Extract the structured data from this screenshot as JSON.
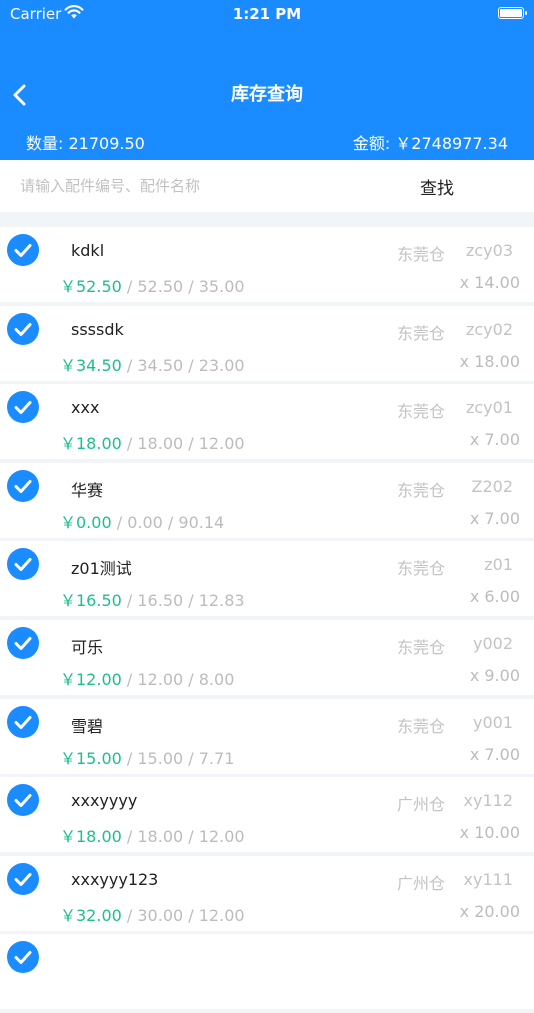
{
  "status": {
    "carrier": "Carrier",
    "time": "1:21 PM"
  },
  "header": {
    "title": "库存查询"
  },
  "summary": {
    "qty_label": "数量: 21709.50",
    "amount_label": "金额: ￥2748977.34"
  },
  "search": {
    "placeholder": "请输入配件编号、配件名称",
    "button_label": "查找"
  },
  "colors": {
    "primary": "#1a8cff",
    "price": "#1dbf8d",
    "muted": "#bcbcbc"
  },
  "items": [
    {
      "name": "kdkl",
      "warehouse": "东莞仓",
      "code": "zcy03",
      "price": "￥52.50",
      "details": " / 52.50 / 35.00",
      "qty": "x 14.00"
    },
    {
      "name": "ssssdk",
      "warehouse": "东莞仓",
      "code": "zcy02",
      "price": "￥34.50",
      "details": " / 34.50 / 23.00",
      "qty": "x 18.00"
    },
    {
      "name": "xxx",
      "warehouse": "东莞仓",
      "code": "zcy01",
      "price": "￥18.00",
      "details": " / 18.00 / 12.00",
      "qty": "x 7.00"
    },
    {
      "name": "华赛",
      "warehouse": "东莞仓",
      "code": "Z202",
      "price": "￥0.00",
      "details": " / 0.00 / 90.14",
      "qty": "x 7.00"
    },
    {
      "name": "z01测试",
      "warehouse": "东莞仓",
      "code": "z01",
      "price": "￥16.50",
      "details": " / 16.50 / 12.83",
      "qty": "x 6.00"
    },
    {
      "name": "可乐",
      "warehouse": "东莞仓",
      "code": "y002",
      "price": "￥12.00",
      "details": " / 12.00 / 8.00",
      "qty": "x 9.00"
    },
    {
      "name": "雪碧",
      "warehouse": "东莞仓",
      "code": "y001",
      "price": "￥15.00",
      "details": " / 15.00 / 7.71",
      "qty": "x 7.00"
    },
    {
      "name": "xxxyyyy",
      "warehouse": "广州仓",
      "code": "xy112",
      "price": "￥18.00",
      "details": " / 18.00 / 12.00",
      "qty": "x 10.00"
    },
    {
      "name": "xxxyyy123",
      "warehouse": "广州仓",
      "code": "xy111",
      "price": "￥32.00",
      "details": " / 30.00 / 12.00",
      "qty": "x 20.00"
    }
  ]
}
